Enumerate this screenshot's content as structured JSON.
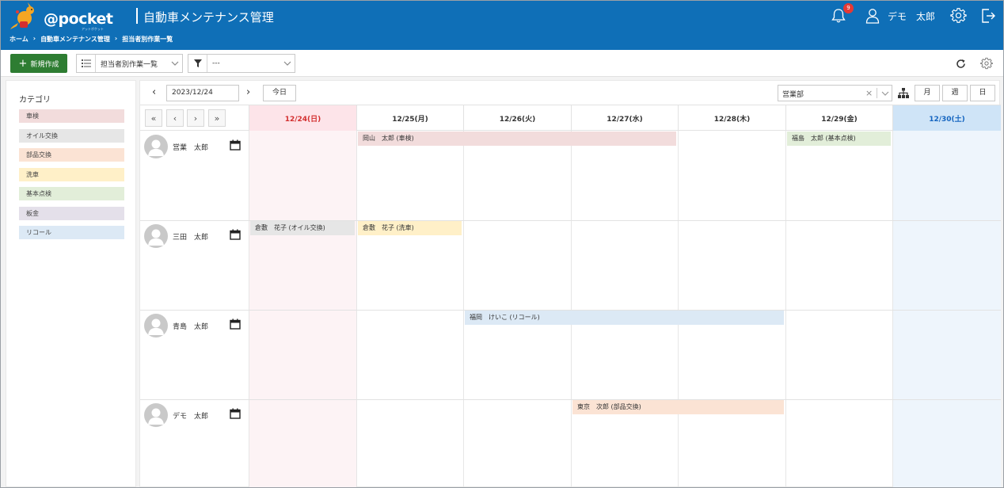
{
  "header": {
    "logo_text": "@pocket",
    "logo_sub": "アットポケット",
    "title": "自動車メンテナンス管理",
    "notification_count": "9",
    "user_name": "デモ　太郎"
  },
  "breadcrumb": [
    "ホーム",
    "自動車メンテナンス管理",
    "担当者別作業一覧"
  ],
  "toolbar": {
    "new_label": "新規作成",
    "view_select": "担当者別作業一覧",
    "filter_select": "---"
  },
  "sidebar": {
    "title": "カテゴリ",
    "categories": [
      {
        "label": "車検",
        "color": "#f2dcdc"
      },
      {
        "label": "オイル交換",
        "color": "#e6e6e6"
      },
      {
        "label": "部品交換",
        "color": "#fbe3d4"
      },
      {
        "label": "洗車",
        "color": "#fff0c8"
      },
      {
        "label": "基本点検",
        "color": "#e2eed9"
      },
      {
        "label": "板金",
        "color": "#e4e0ea"
      },
      {
        "label": "リコール",
        "color": "#dce9f5"
      }
    ]
  },
  "calendar": {
    "date": "2023/12/24",
    "today_label": "今日",
    "department": "営業部",
    "views": [
      "月",
      "週",
      "日"
    ],
    "days": [
      {
        "label": "12/24(日)",
        "type": "sun"
      },
      {
        "label": "12/25(月)",
        "type": "weekday"
      },
      {
        "label": "12/26(火)",
        "type": "weekday"
      },
      {
        "label": "12/27(水)",
        "type": "weekday"
      },
      {
        "label": "12/28(木)",
        "type": "weekday"
      },
      {
        "label": "12/29(金)",
        "type": "weekday"
      },
      {
        "label": "12/30(土)",
        "type": "sat"
      }
    ],
    "staff": [
      {
        "name": "営業　太郎",
        "events": [
          {
            "label": "岡山　太郎 (車検)",
            "start": 1,
            "span": 3,
            "category": 0
          },
          {
            "label": "福島　太郎 (基本点検)",
            "start": 5,
            "span": 1,
            "category": 4
          }
        ]
      },
      {
        "name": "三田　太郎",
        "events": [
          {
            "label": "倉敷　花子 (オイル交換)",
            "start": 0,
            "span": 1,
            "category": 1
          },
          {
            "label": "倉敷　花子 (洗車)",
            "start": 1,
            "span": 1,
            "category": 3
          }
        ]
      },
      {
        "name": "青島　太郎",
        "events": [
          {
            "label": "福岡　けいこ (リコール)",
            "start": 2,
            "span": 3,
            "category": 6
          }
        ]
      },
      {
        "name": "デモ　太郎",
        "events": [
          {
            "label": "東京　次郎 (部品交換)",
            "start": 3,
            "span": 2,
            "category": 2
          }
        ]
      }
    ]
  },
  "colors": {
    "header": "#0f6fb7",
    "sunday_text": "#d32f2f",
    "saturday_text": "#1565c0",
    "sunday_bg": "#fdf3f5",
    "saturday_bg": "#eef5fc",
    "new_button": "#2e7d32"
  }
}
